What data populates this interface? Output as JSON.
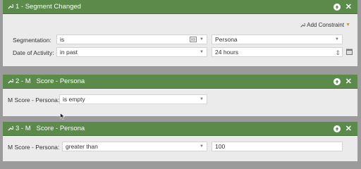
{
  "filters": [
    {
      "title": "1 - Segment Changed",
      "add_constraint": "Add Constraint",
      "rows": [
        {
          "label": "Segmentation:",
          "operator": "is",
          "value": "Persona"
        },
        {
          "label": "Date of Activity:",
          "operator": "in past",
          "value": "24 hours"
        }
      ]
    },
    {
      "title": "2 - M   Score - Persona",
      "rows": [
        {
          "label": "M Score - Persona:",
          "operator": "is empty"
        }
      ]
    },
    {
      "title": "3 - M   Score - Persona",
      "rows": [
        {
          "label": "M Score - Persona:",
          "operator": "greater than",
          "value": "100"
        }
      ]
    }
  ],
  "colors": {
    "header": "#5b8a4a",
    "panel": "#ebebeb",
    "background": "#9b9b9b"
  },
  "icons": [
    "wrench-icon",
    "arrow-up-icon",
    "close-icon",
    "list-icon",
    "chevron-down-icon",
    "calendar-icon"
  ]
}
